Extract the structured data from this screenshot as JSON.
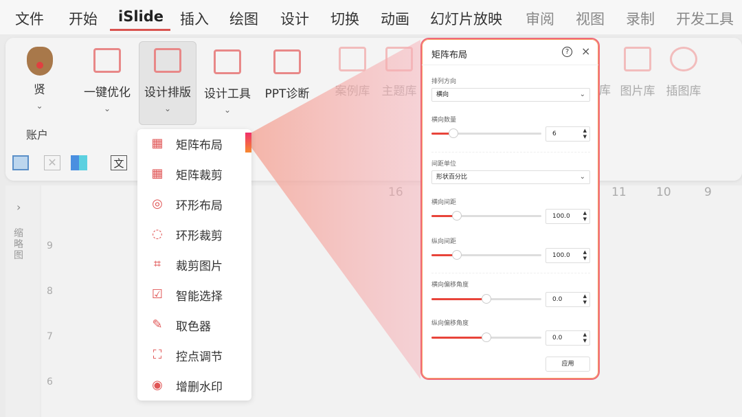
{
  "menubar": {
    "tabs": [
      "文件",
      "开始",
      "iSlide",
      "插入",
      "绘图",
      "设计",
      "切换",
      "动画",
      "幻灯片放映",
      "审阅",
      "视图",
      "录制",
      "开发工具"
    ],
    "active": "iSlide"
  },
  "ribbon": {
    "account_name": "贤",
    "account_group": "账户",
    "buttons": [
      "一键优化",
      "设计排版",
      "设计工具",
      "PPT诊断",
      "案例库",
      "主题库"
    ],
    "right_buttons": [
      "库",
      "图片库",
      "插图库"
    ]
  },
  "sidebar": {
    "label": "缩略图",
    "expand": "›"
  },
  "ruler": {
    "h_ticks": [
      "16",
      "11",
      "10",
      "9"
    ],
    "v_ticks": [
      "9",
      "8",
      "7",
      "6"
    ]
  },
  "dropdown": {
    "items": [
      {
        "label": "矩阵布局",
        "icon": "grid-icon"
      },
      {
        "label": "矩阵裁剪",
        "icon": "grid-crop-icon"
      },
      {
        "label": "环形布局",
        "icon": "ring-icon"
      },
      {
        "label": "环形裁剪",
        "icon": "ring-crop-icon"
      },
      {
        "label": "裁剪图片",
        "icon": "crop-icon"
      },
      {
        "label": "智能选择",
        "icon": "smart-select-icon"
      },
      {
        "label": "取色器",
        "icon": "eyedropper-icon"
      },
      {
        "label": "控点调节",
        "icon": "handles-icon"
      },
      {
        "label": "增删水印",
        "icon": "watermark-icon"
      }
    ]
  },
  "dialog": {
    "title": "矩阵布局",
    "help": "?",
    "close": "×",
    "direction_label": "排列方向",
    "direction_value": "横向",
    "count_label": "横向数量",
    "count_value": "6",
    "count_fraction": 0.2,
    "unit_label": "间距单位",
    "unit_value": "形状百分比",
    "h_gap_label": "横向间距",
    "h_gap_value": "100.0",
    "h_gap_fraction": 0.23,
    "v_gap_label": "纵向间距",
    "v_gap_value": "100.0",
    "v_gap_fraction": 0.23,
    "h_angle_label": "横向偏移角度",
    "h_angle_value": "0.0",
    "h_angle_fraction": 0.5,
    "v_angle_label": "纵向偏移角度",
    "v_angle_value": "0.0",
    "v_angle_fraction": 0.5,
    "apply": "应用"
  },
  "colors": {
    "accent": "#e8443a",
    "border": "#f06a7a"
  }
}
